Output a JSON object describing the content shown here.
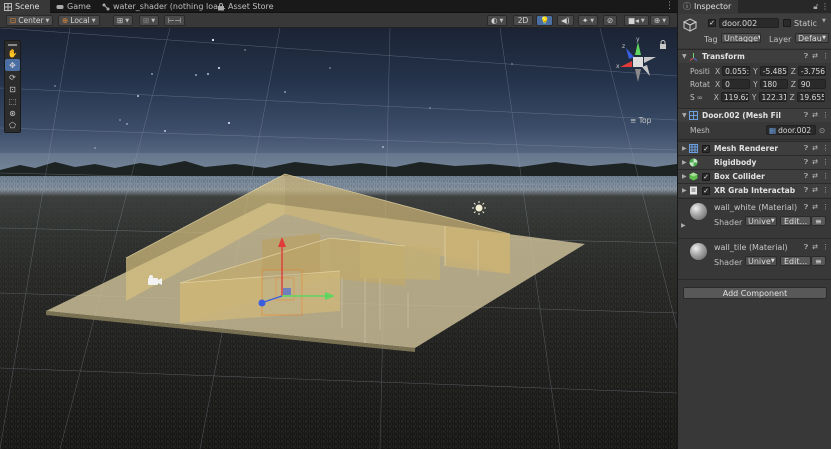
{
  "tabs": [
    {
      "label": "Scene",
      "icon": "scene-grid-icon",
      "active": true
    },
    {
      "label": "Game",
      "icon": "game-controller-icon",
      "active": false
    },
    {
      "label": "water_shader (nothing loa…",
      "icon": "shader-graph-icon",
      "active": false
    },
    {
      "label": "Asset Store",
      "icon": "store-bag-icon",
      "active": false
    }
  ],
  "scene_toolbar": {
    "pivot": "Center",
    "space": "Local",
    "mode_2d": "2D"
  },
  "tools": [
    "hand-tool",
    "move-tool",
    "rotate-tool",
    "scale-tool",
    "rect-tool",
    "transform-tool",
    "custom-tool"
  ],
  "gizmo": {
    "view_label": "Top"
  },
  "inspector": {
    "tab_label": "Inspector",
    "object": {
      "name": "door.002",
      "static_label": "Static",
      "tag_label": "Tag",
      "tag_value": "Untagge",
      "layer_label": "Layer",
      "layer_value": "Defau"
    },
    "transform": {
      "title": "Transform",
      "position_label": "Positi",
      "position": {
        "x": "0.055:",
        "y": "-5.485",
        "z": "-3.756"
      },
      "rotation_label": "Rotat",
      "rotation": {
        "x": "0",
        "y": "180",
        "z": "90"
      },
      "scale_label": "S",
      "scale": {
        "x": "119.62",
        "y": "122.31",
        "z": "19.655"
      }
    },
    "mesh_filter": {
      "title": "Door.002 (Mesh Fil",
      "mesh_label": "Mesh",
      "mesh_value": "door.002"
    },
    "components": [
      {
        "title": "Mesh Renderer",
        "icon": "mesh-renderer-icon",
        "checkbox": true
      },
      {
        "title": "Rigidbody",
        "icon": "rigidbody-icon",
        "checkbox": false
      },
      {
        "title": "Box Collider",
        "icon": "box-collider-icon",
        "checkbox": true
      },
      {
        "title": "XR Grab Interactab",
        "icon": "script-icon",
        "checkbox": true
      }
    ],
    "materials": [
      {
        "name": "wall_white (Material)",
        "shader_label": "Shader",
        "shader_value": "Unive",
        "edit_label": "Edit..."
      },
      {
        "name": "wall_tile (Material)",
        "shader_label": "Shader",
        "shader_value": "Unive",
        "edit_label": "Edit..."
      }
    ],
    "add_component": "Add Component"
  },
  "colors": {
    "selection_blue": "#4b6ea3",
    "panel_bg": "#383838",
    "axis_y": "#e03a3a",
    "axis_x": "#5fd65f",
    "axis_z": "#3a5ee0",
    "selection_outline": "#f07a1e"
  }
}
